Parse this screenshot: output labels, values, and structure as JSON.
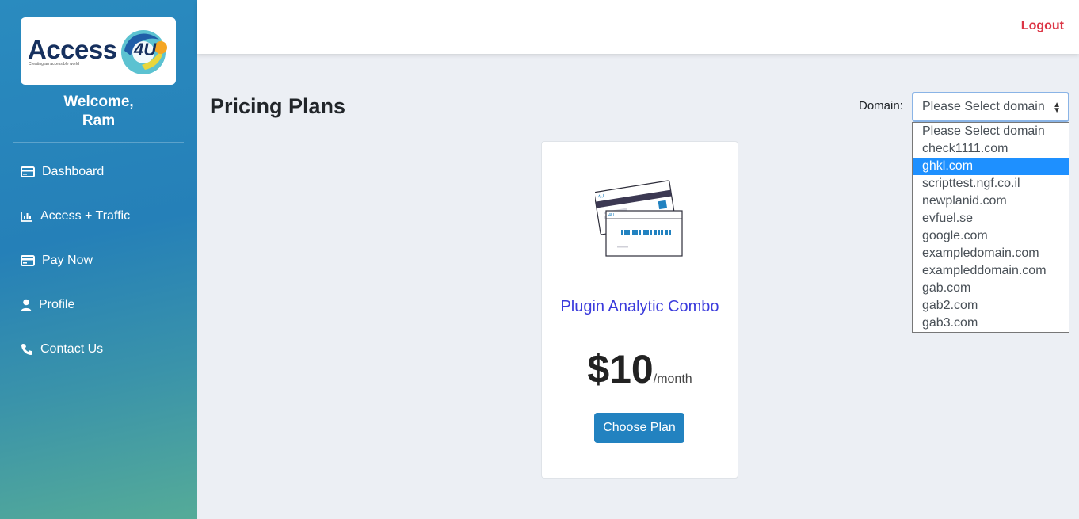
{
  "brand": {
    "logo_text": "Access",
    "logo_badge": "4U",
    "logo_tagline": "Creating an accessible world"
  },
  "sidebar": {
    "welcome": "Welcome,",
    "user": "Ram",
    "items": [
      {
        "label": "Dashboard",
        "icon": "card-icon"
      },
      {
        "label": "Access + Traffic",
        "icon": "bar-chart-icon"
      },
      {
        "label": "Pay Now",
        "icon": "card-icon"
      },
      {
        "label": "Profile",
        "icon": "user-icon"
      },
      {
        "label": "Contact Us",
        "icon": "phone-icon"
      }
    ]
  },
  "header": {
    "logout": "Logout"
  },
  "main": {
    "title": "Pricing Plans"
  },
  "domain": {
    "label": "Domain:",
    "selected": "Please Select domain",
    "highlighted": "ghkl.com",
    "options": [
      "Please Select domain",
      "check1111.com",
      "ghkl.com",
      "scripttest.ngf.co.il",
      "newplanid.com",
      "evfuel.se",
      "google.com",
      "exampledomain.com",
      "exampleddomain.com",
      "gab.com",
      "gab2.com",
      "gab3.com"
    ]
  },
  "plan": {
    "name": "Plugin Analytic Combo",
    "price": "$10",
    "period": "/month",
    "button": "Choose Plan"
  },
  "colors": {
    "accent": "#2282c0",
    "logout": "#dc3545",
    "plan_name": "#3b3bdc",
    "highlight": "#1e90ff"
  }
}
